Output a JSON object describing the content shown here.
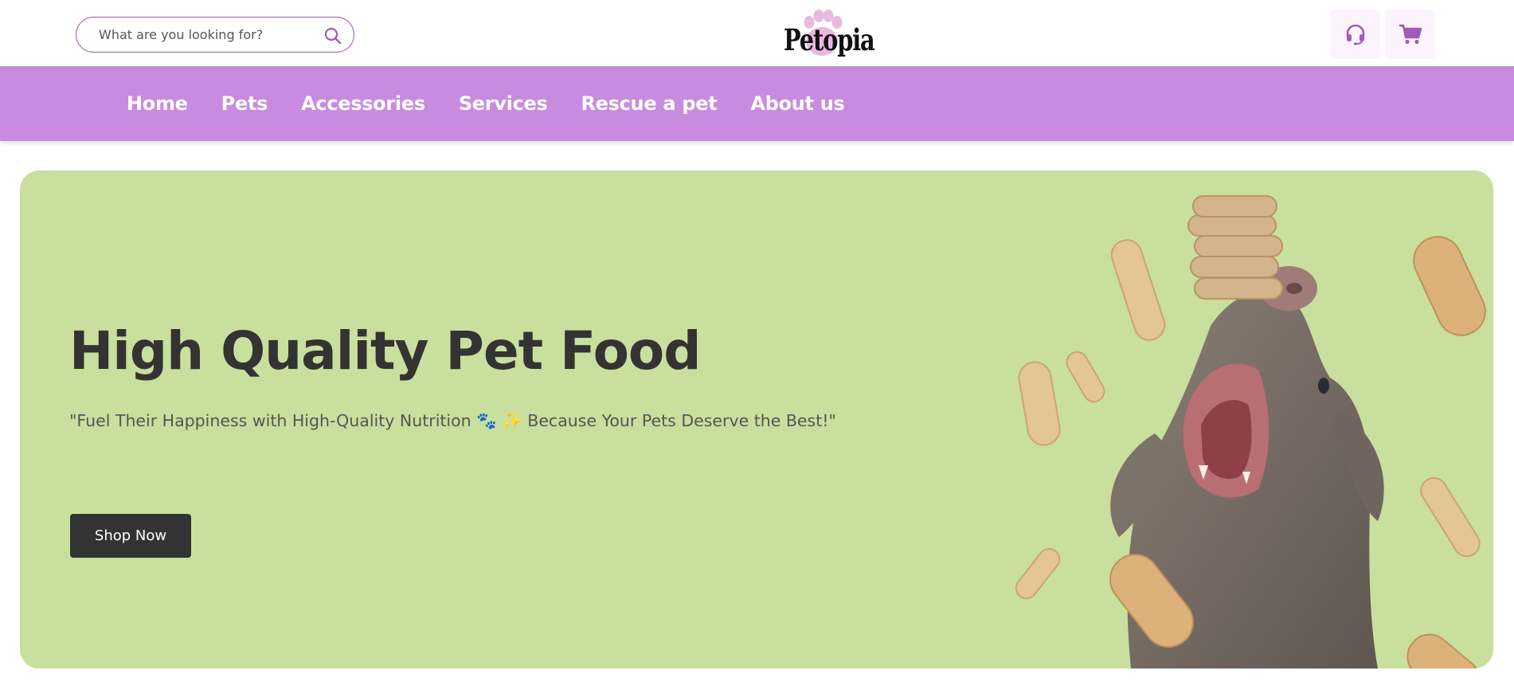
{
  "header": {
    "search_placeholder": "What are you looking for?",
    "logo_text": "Petopia",
    "icons": {
      "search": "search-icon",
      "support": "headset-icon",
      "cart": "cart-icon"
    }
  },
  "nav": {
    "items": [
      "Home",
      "Pets",
      "Accessories",
      "Services",
      "Rescue a pet",
      "About us"
    ]
  },
  "hero": {
    "title": "High Quality Pet Food",
    "subtitle": "\"Fuel Their Happiness with High-Quality Nutrition 🐾 ✨ Because Your Pets Deserve the Best!\"",
    "cta_label": "Shop Now"
  },
  "colors": {
    "accent": "#c98bdf",
    "accent_dark": "#a05bb8",
    "hero_bg": "#c9df9d",
    "button_bg": "#333333"
  }
}
